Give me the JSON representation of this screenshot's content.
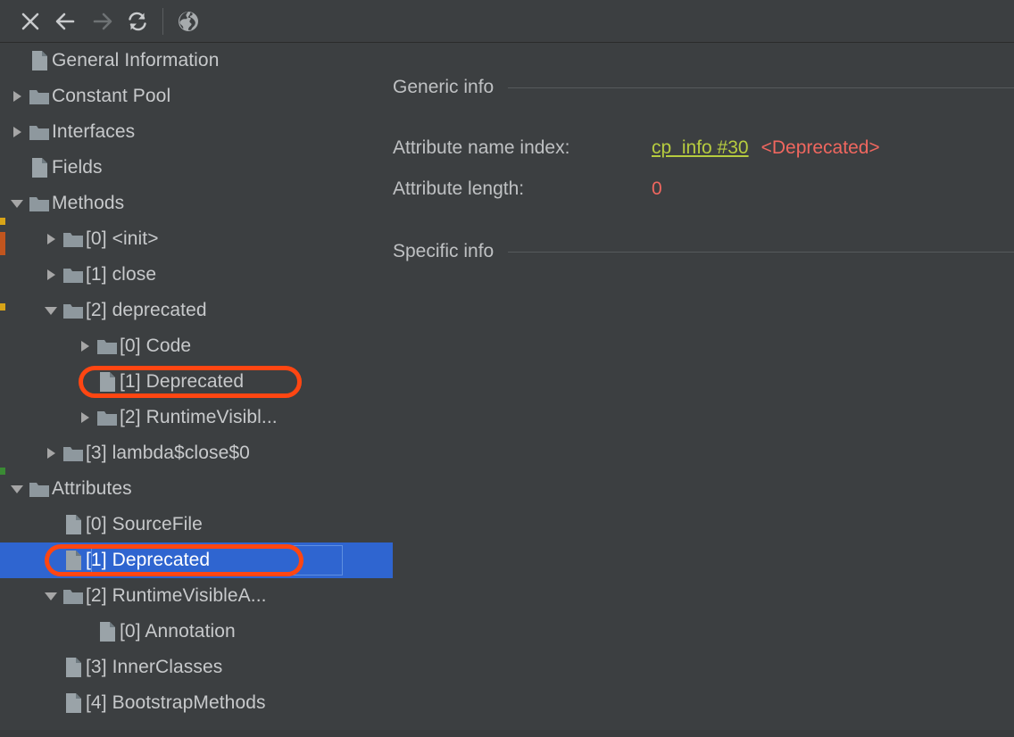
{
  "toolbar": {
    "buttons": [
      {
        "name": "close-icon",
        "label": "Close",
        "enabled": true
      },
      {
        "name": "back-arrow-icon",
        "label": "Back",
        "enabled": true
      },
      {
        "name": "forward-arrow-icon",
        "label": "Forward",
        "enabled": false
      },
      {
        "name": "reload-icon",
        "label": "Reload",
        "enabled": true
      },
      {
        "name": "globe-icon",
        "label": "Browse",
        "enabled": true
      }
    ]
  },
  "colors": {
    "background": "#3c3f41",
    "selection": "#2f65d0",
    "annotation": "#ff4612",
    "link": "#b7cc3f",
    "value_red": "#f0675f",
    "text": "#c7c9cb"
  },
  "tree": {
    "rows": [
      {
        "label": "General Information",
        "indent": 0,
        "icon": "file-icon",
        "twisty": "none",
        "selected": false
      },
      {
        "label": "Constant Pool",
        "indent": 0,
        "icon": "folder-icon",
        "twisty": "collapsed",
        "selected": false
      },
      {
        "label": "Interfaces",
        "indent": 0,
        "icon": "folder-icon",
        "twisty": "collapsed",
        "selected": false
      },
      {
        "label": "Fields",
        "indent": 0,
        "icon": "file-icon",
        "twisty": "none",
        "selected": false
      },
      {
        "label": "Methods",
        "indent": 0,
        "icon": "folder-icon",
        "twisty": "expanded",
        "selected": false
      },
      {
        "label": "[0] <init>",
        "indent": 1,
        "icon": "folder-icon",
        "twisty": "collapsed",
        "selected": false
      },
      {
        "label": "[1] close",
        "indent": 1,
        "icon": "folder-icon",
        "twisty": "collapsed",
        "selected": false
      },
      {
        "label": "[2] deprecated",
        "indent": 1,
        "icon": "folder-icon",
        "twisty": "expanded",
        "selected": false
      },
      {
        "label": "[0] Code",
        "indent": 2,
        "icon": "folder-icon",
        "twisty": "collapsed",
        "selected": false
      },
      {
        "label": "[1] Deprecated",
        "indent": 2,
        "icon": "file-icon",
        "twisty": "none",
        "selected": false,
        "annotated": true
      },
      {
        "label": "[2] RuntimeVisibl...",
        "indent": 2,
        "icon": "folder-icon",
        "twisty": "collapsed",
        "selected": false
      },
      {
        "label": "[3] lambda$close$0",
        "indent": 1,
        "icon": "folder-icon",
        "twisty": "collapsed",
        "selected": false
      },
      {
        "label": "Attributes",
        "indent": 0,
        "icon": "folder-icon",
        "twisty": "expanded",
        "selected": false
      },
      {
        "label": "[0] SourceFile",
        "indent": 1,
        "icon": "file-icon",
        "twisty": "none",
        "selected": false
      },
      {
        "label": "[1] Deprecated",
        "indent": 1,
        "icon": "file-icon",
        "twisty": "none",
        "selected": true,
        "annotated": true
      },
      {
        "label": "[2] RuntimeVisibleA...",
        "indent": 1,
        "icon": "folder-icon",
        "twisty": "expanded",
        "selected": false
      },
      {
        "label": "[0] Annotation",
        "indent": 2,
        "icon": "file-icon",
        "twisty": "none",
        "selected": false
      },
      {
        "label": "[3] InnerClasses",
        "indent": 1,
        "icon": "file-icon",
        "twisty": "none",
        "selected": false
      },
      {
        "label": "[4] BootstrapMethods",
        "indent": 1,
        "icon": "file-icon",
        "twisty": "none",
        "selected": false
      }
    ]
  },
  "detail": {
    "generic_info_title": "Generic info",
    "specific_info_title": "Specific info",
    "fields": [
      {
        "key": "Attribute name index:",
        "link": "cp_info #30",
        "annotation": "<Deprecated>"
      },
      {
        "key": "Attribute length:",
        "value": "0"
      }
    ]
  }
}
